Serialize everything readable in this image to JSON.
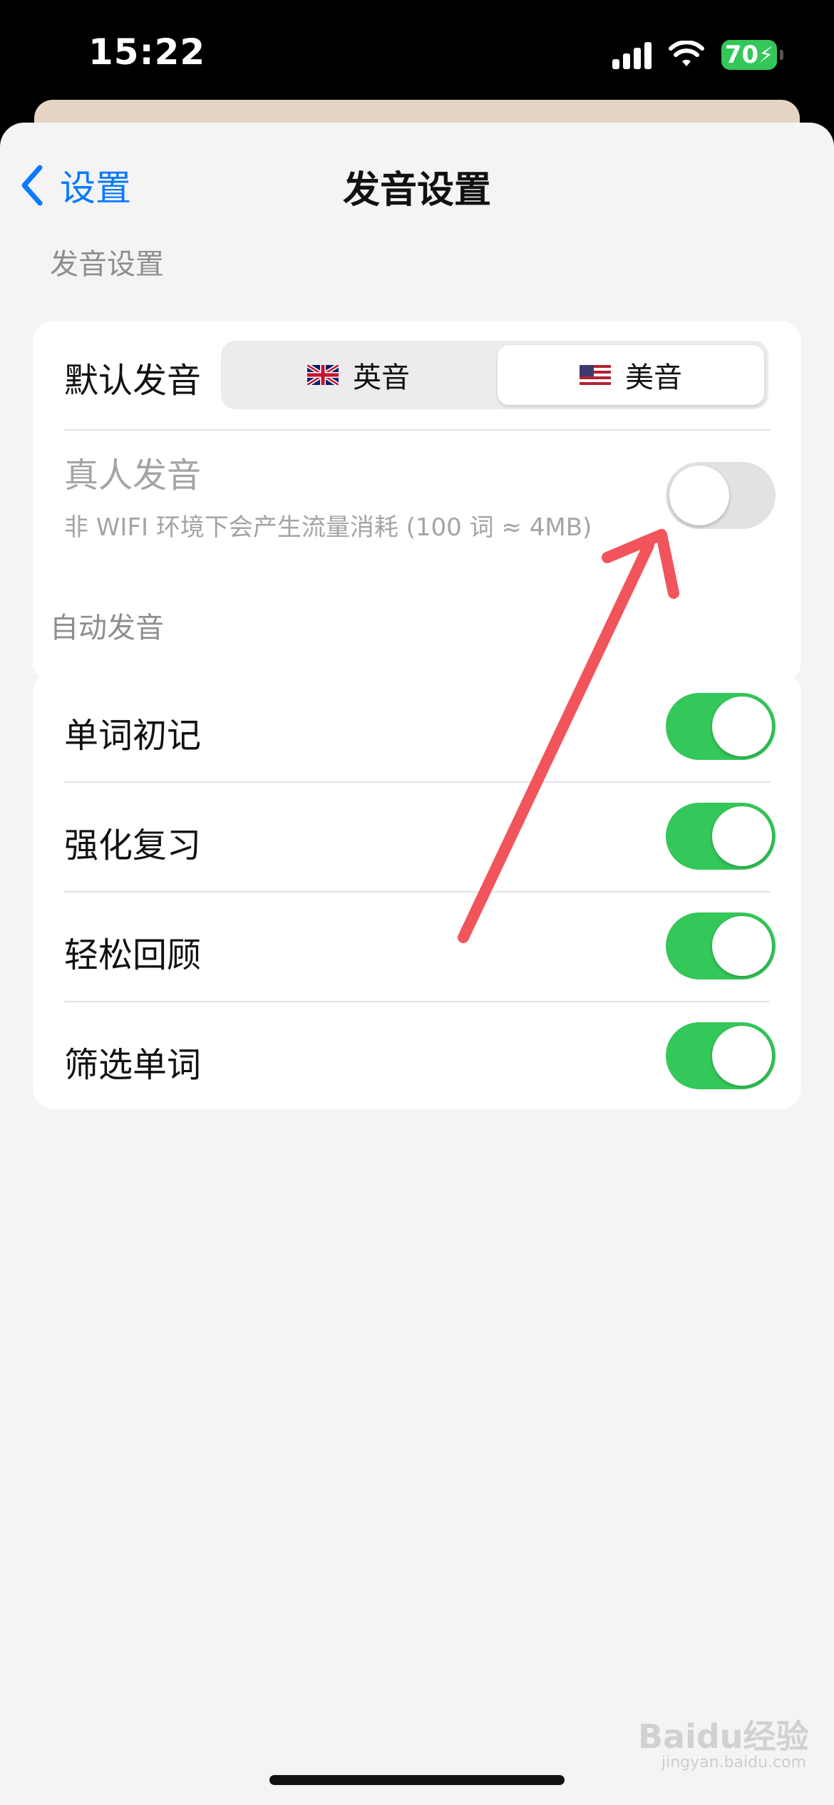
{
  "status_bar": {
    "time": "15:22",
    "battery": "70"
  },
  "nav": {
    "back_label": "设置",
    "title": "发音设置"
  },
  "section1": {
    "header": "发音设置",
    "default_label": "默认发音",
    "segments": [
      {
        "label": "英音",
        "flag": "uk-flag-icon",
        "selected": false
      },
      {
        "label": "美音",
        "flag": "us-flag-icon",
        "selected": true
      }
    ],
    "real_voice": {
      "label": "真人发音",
      "subtitle": "非 WIFI 环境下会产生流量消耗 (100 词 ≈ 4MB)",
      "enabled": false
    }
  },
  "section2": {
    "header": "自动发音",
    "items": [
      {
        "label": "单词初记",
        "enabled": true
      },
      {
        "label": "强化复习",
        "enabled": true
      },
      {
        "label": "轻松回顾",
        "enabled": true
      },
      {
        "label": "筛选单词",
        "enabled": true
      }
    ]
  },
  "watermark": {
    "brand": "Baidu经验",
    "url": "jingyan.baidu.com"
  },
  "colors": {
    "accent": "#0a7aff",
    "toggle_on": "#34c759",
    "annotation_arrow": "#f2545b"
  }
}
